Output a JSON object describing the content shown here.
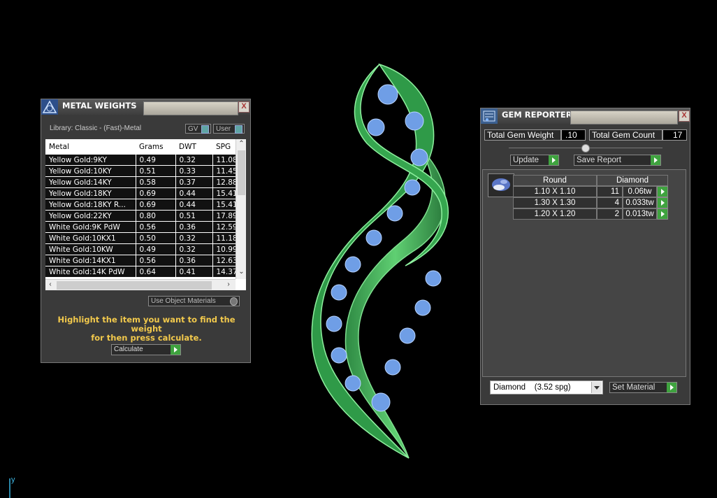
{
  "metal_weights": {
    "title": "METAL WEIGHTS",
    "close_label": "X",
    "library_label": "Library: Classic - (Fast)-Metal",
    "toggle_gv": "GV",
    "toggle_user": "User",
    "columns": [
      "Metal",
      "Grams",
      "DWT",
      "SPG"
    ],
    "rows": [
      [
        "Yellow Gold:9KY",
        "0.49",
        "0.32",
        "11.08"
      ],
      [
        "Yellow Gold:10KY",
        "0.51",
        "0.33",
        "11.45"
      ],
      [
        "Yellow Gold:14KY",
        "0.58",
        "0.37",
        "12.88"
      ],
      [
        "Yellow Gold:18KY",
        "0.69",
        "0.44",
        "15.41"
      ],
      [
        "Yellow Gold:18KY R...",
        "0.69",
        "0.44",
        "15.41"
      ],
      [
        "Yellow Gold:22KY",
        "0.80",
        "0.51",
        "17.89"
      ],
      [
        "White Gold:9K PdW",
        "0.56",
        "0.36",
        "12.59"
      ],
      [
        "White Gold:10KX1",
        "0.50",
        "0.32",
        "11.18"
      ],
      [
        "White Gold:10KW",
        "0.49",
        "0.32",
        "10.99"
      ],
      [
        "White Gold:14KX1",
        "0.56",
        "0.36",
        "12.63"
      ],
      [
        "White Gold:14K PdW",
        "0.64",
        "0.41",
        "14.37"
      ]
    ],
    "use_object_materials": "Use Object Materials",
    "hint_line1": "Highlight the item you want to find the weight",
    "hint_line2": "for then press calculate.",
    "calculate_label": "Calculate"
  },
  "gem_reporter": {
    "title": "GEM REPORTER",
    "close_label": "X",
    "total_weight_label": "Total Gem Weight",
    "total_weight_value": ".10",
    "total_count_label": "Total Gem Count",
    "total_count_value": "17",
    "update_label": "Update",
    "save_report_label": "Save Report",
    "head_shape": "Round",
    "head_material": "Diamond",
    "gems": [
      {
        "size": "1.10 X 1.10",
        "count": "11",
        "weight": "0.06tw"
      },
      {
        "size": "1.30 X 1.30",
        "count": "4",
        "weight": "0.033tw"
      },
      {
        "size": "1.20 X 1.20",
        "count": "2",
        "weight": "0.013tw"
      }
    ],
    "material_select": "Diamond    (3.52 spg)",
    "set_material_label": "Set Material"
  },
  "viewport": {
    "axis_label": "y",
    "model_color": "#3fbf5a",
    "gem_color": "#6f9ee6"
  }
}
